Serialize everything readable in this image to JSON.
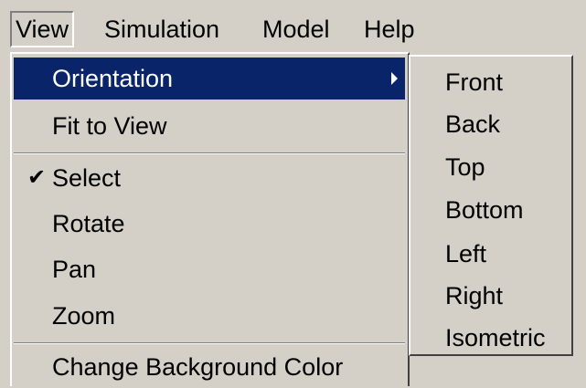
{
  "menubar": {
    "items": [
      {
        "label": "View"
      },
      {
        "label": "Simulation"
      },
      {
        "label": "Model"
      },
      {
        "label": "Help"
      }
    ]
  },
  "view_menu": {
    "items": [
      {
        "label": "Orientation",
        "highlighted": true,
        "has_submenu": true
      },
      {
        "label": "Fit to View"
      },
      {
        "label": "Select",
        "checked": true,
        "check_glyph": "✔"
      },
      {
        "label": "Rotate"
      },
      {
        "label": "Pan"
      },
      {
        "label": "Zoom"
      },
      {
        "label": "Change Background Color"
      }
    ]
  },
  "orientation_submenu": {
    "items": [
      {
        "label": "Front"
      },
      {
        "label": "Back"
      },
      {
        "label": "Top"
      },
      {
        "label": "Bottom"
      },
      {
        "label": "Left"
      },
      {
        "label": "Right"
      },
      {
        "label": "Isometric"
      }
    ]
  },
  "colors": {
    "menu_bg": "#d4d0c8",
    "highlight_bg": "#0a246a",
    "highlight_text": "#ffffff"
  }
}
